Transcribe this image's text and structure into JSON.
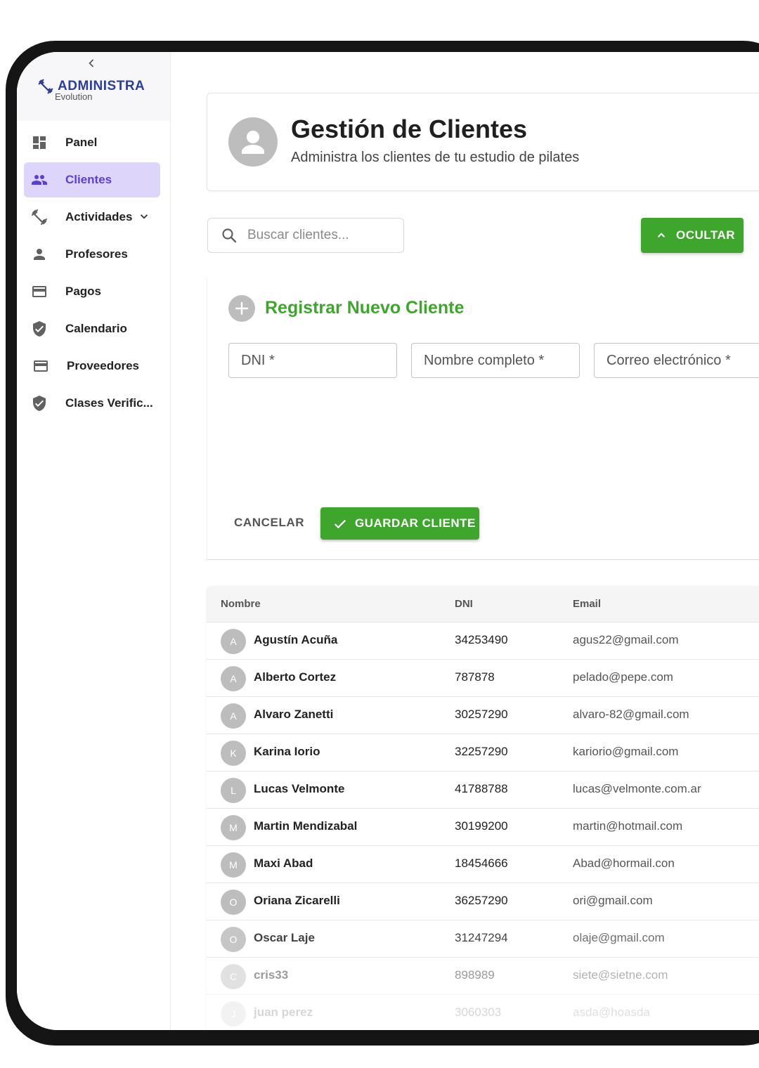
{
  "sidebar": {
    "collapse_glyph": "‹",
    "logo": {
      "title": "ADMINISTRA",
      "subtitle": "Evolution"
    },
    "items": [
      {
        "label": "Panel",
        "icon": "dashboard-icon",
        "active": false
      },
      {
        "label": "Clientes",
        "icon": "people-icon",
        "active": true
      },
      {
        "label": "Actividades",
        "icon": "fitness-icon",
        "active": false,
        "expandable": true
      },
      {
        "label": "Profesores",
        "icon": "person-icon",
        "active": false
      },
      {
        "label": "Pagos",
        "icon": "credit-card-icon",
        "active": false
      },
      {
        "label": "Calendario",
        "icon": "shield-check-icon",
        "active": false
      },
      {
        "label": "Proveedores",
        "icon": "credit-card-icon",
        "active": false
      },
      {
        "label": "Clases Verific...",
        "icon": "shield-check-icon",
        "active": false
      }
    ]
  },
  "header": {
    "title": "Gestión de Clientes",
    "subtitle": "Administra los clientes de tu estudio de pilates"
  },
  "search": {
    "placeholder": "Buscar clientes...",
    "value": ""
  },
  "toggle_button": {
    "label": "OCULTAR"
  },
  "form": {
    "title": "Registrar Nuevo Cliente",
    "fields": {
      "dni": "DNI *",
      "name": "Nombre completo *",
      "email": "Correo electrónico *"
    },
    "cancel_label": "CANCELAR",
    "save_label": "GUARDAR CLIENTE"
  },
  "table": {
    "columns": [
      "Nombre",
      "DNI",
      "Email"
    ],
    "rows": [
      {
        "initial": "A",
        "name": "Agustín Acuña",
        "dni": "34253490",
        "email": "agus22@gmail.com"
      },
      {
        "initial": "A",
        "name": "Alberto Cortez",
        "dni": "787878",
        "email": "pelado@pepe.com"
      },
      {
        "initial": "A",
        "name": "Alvaro Zanetti",
        "dni": "30257290",
        "email": "alvaro-82@gmail.com"
      },
      {
        "initial": "K",
        "name": "Karina Iorio",
        "dni": "32257290",
        "email": "kariorio@gmail.com"
      },
      {
        "initial": "L",
        "name": "Lucas Velmonte",
        "dni": "41788788",
        "email": "lucas@velmonte.com.ar"
      },
      {
        "initial": "M",
        "name": "Martin Mendizabal",
        "dni": "30199200",
        "email": "martin@hotmail.com"
      },
      {
        "initial": "M",
        "name": "Maxi Abad",
        "dni": "18454666",
        "email": "Abad@hormail.con"
      },
      {
        "initial": "O",
        "name": "Oriana Zicarelli",
        "dni": "36257290",
        "email": "ori@gmail.com"
      },
      {
        "initial": "O",
        "name": "Oscar Laje",
        "dni": "31247294",
        "email": "olaje@gmail.com"
      },
      {
        "initial": "C",
        "name": "cris33",
        "dni": "898989",
        "email": "siete@sietne.com"
      },
      {
        "initial": "J",
        "name": "juan perez",
        "dni": "3060303",
        "email": "asda@hoasda"
      }
    ]
  },
  "colors": {
    "primary_green": "#3ea52d",
    "brand_blue": "#2c3e9a",
    "active_purple": "#5b3fd4",
    "active_bg": "#ded5fb"
  }
}
